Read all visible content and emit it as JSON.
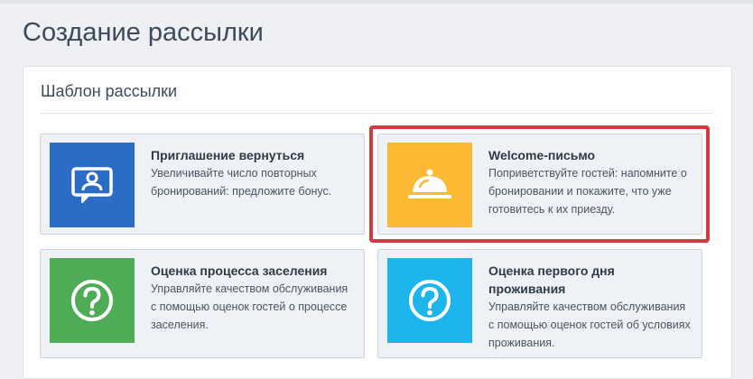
{
  "page": {
    "title": "Создание рассылки"
  },
  "panel": {
    "title": "Шаблон рассылки"
  },
  "cards": [
    {
      "title": "Приглашение вернуться",
      "description": "Увеличивайте число повторных бронирований: предложите бонус.",
      "color": "#2a6cc6",
      "icon": "contact-card-icon"
    },
    {
      "title": "Welcome-письмо",
      "description": "Поприветствуйте гостей: напомните о бронировании и покажите, что уже готовитесь к их приезду.",
      "color": "#fbb934",
      "icon": "service-bell-icon",
      "selected": true,
      "highlight_color": "#d33a3f"
    },
    {
      "title": "Оценка процесса заселения",
      "description": "Управляйте качеством обслуживания с помощью оценок гостей о процессе заселения.",
      "color": "#4fac56",
      "icon": "question-circle-icon"
    },
    {
      "title": "Оценка первого дня проживания",
      "description": "Управляйте качеством обслуживания с помощью оценок гостей об условиях проживания.",
      "color": "#1cb5ee",
      "icon": "question-circle-icon"
    }
  ]
}
